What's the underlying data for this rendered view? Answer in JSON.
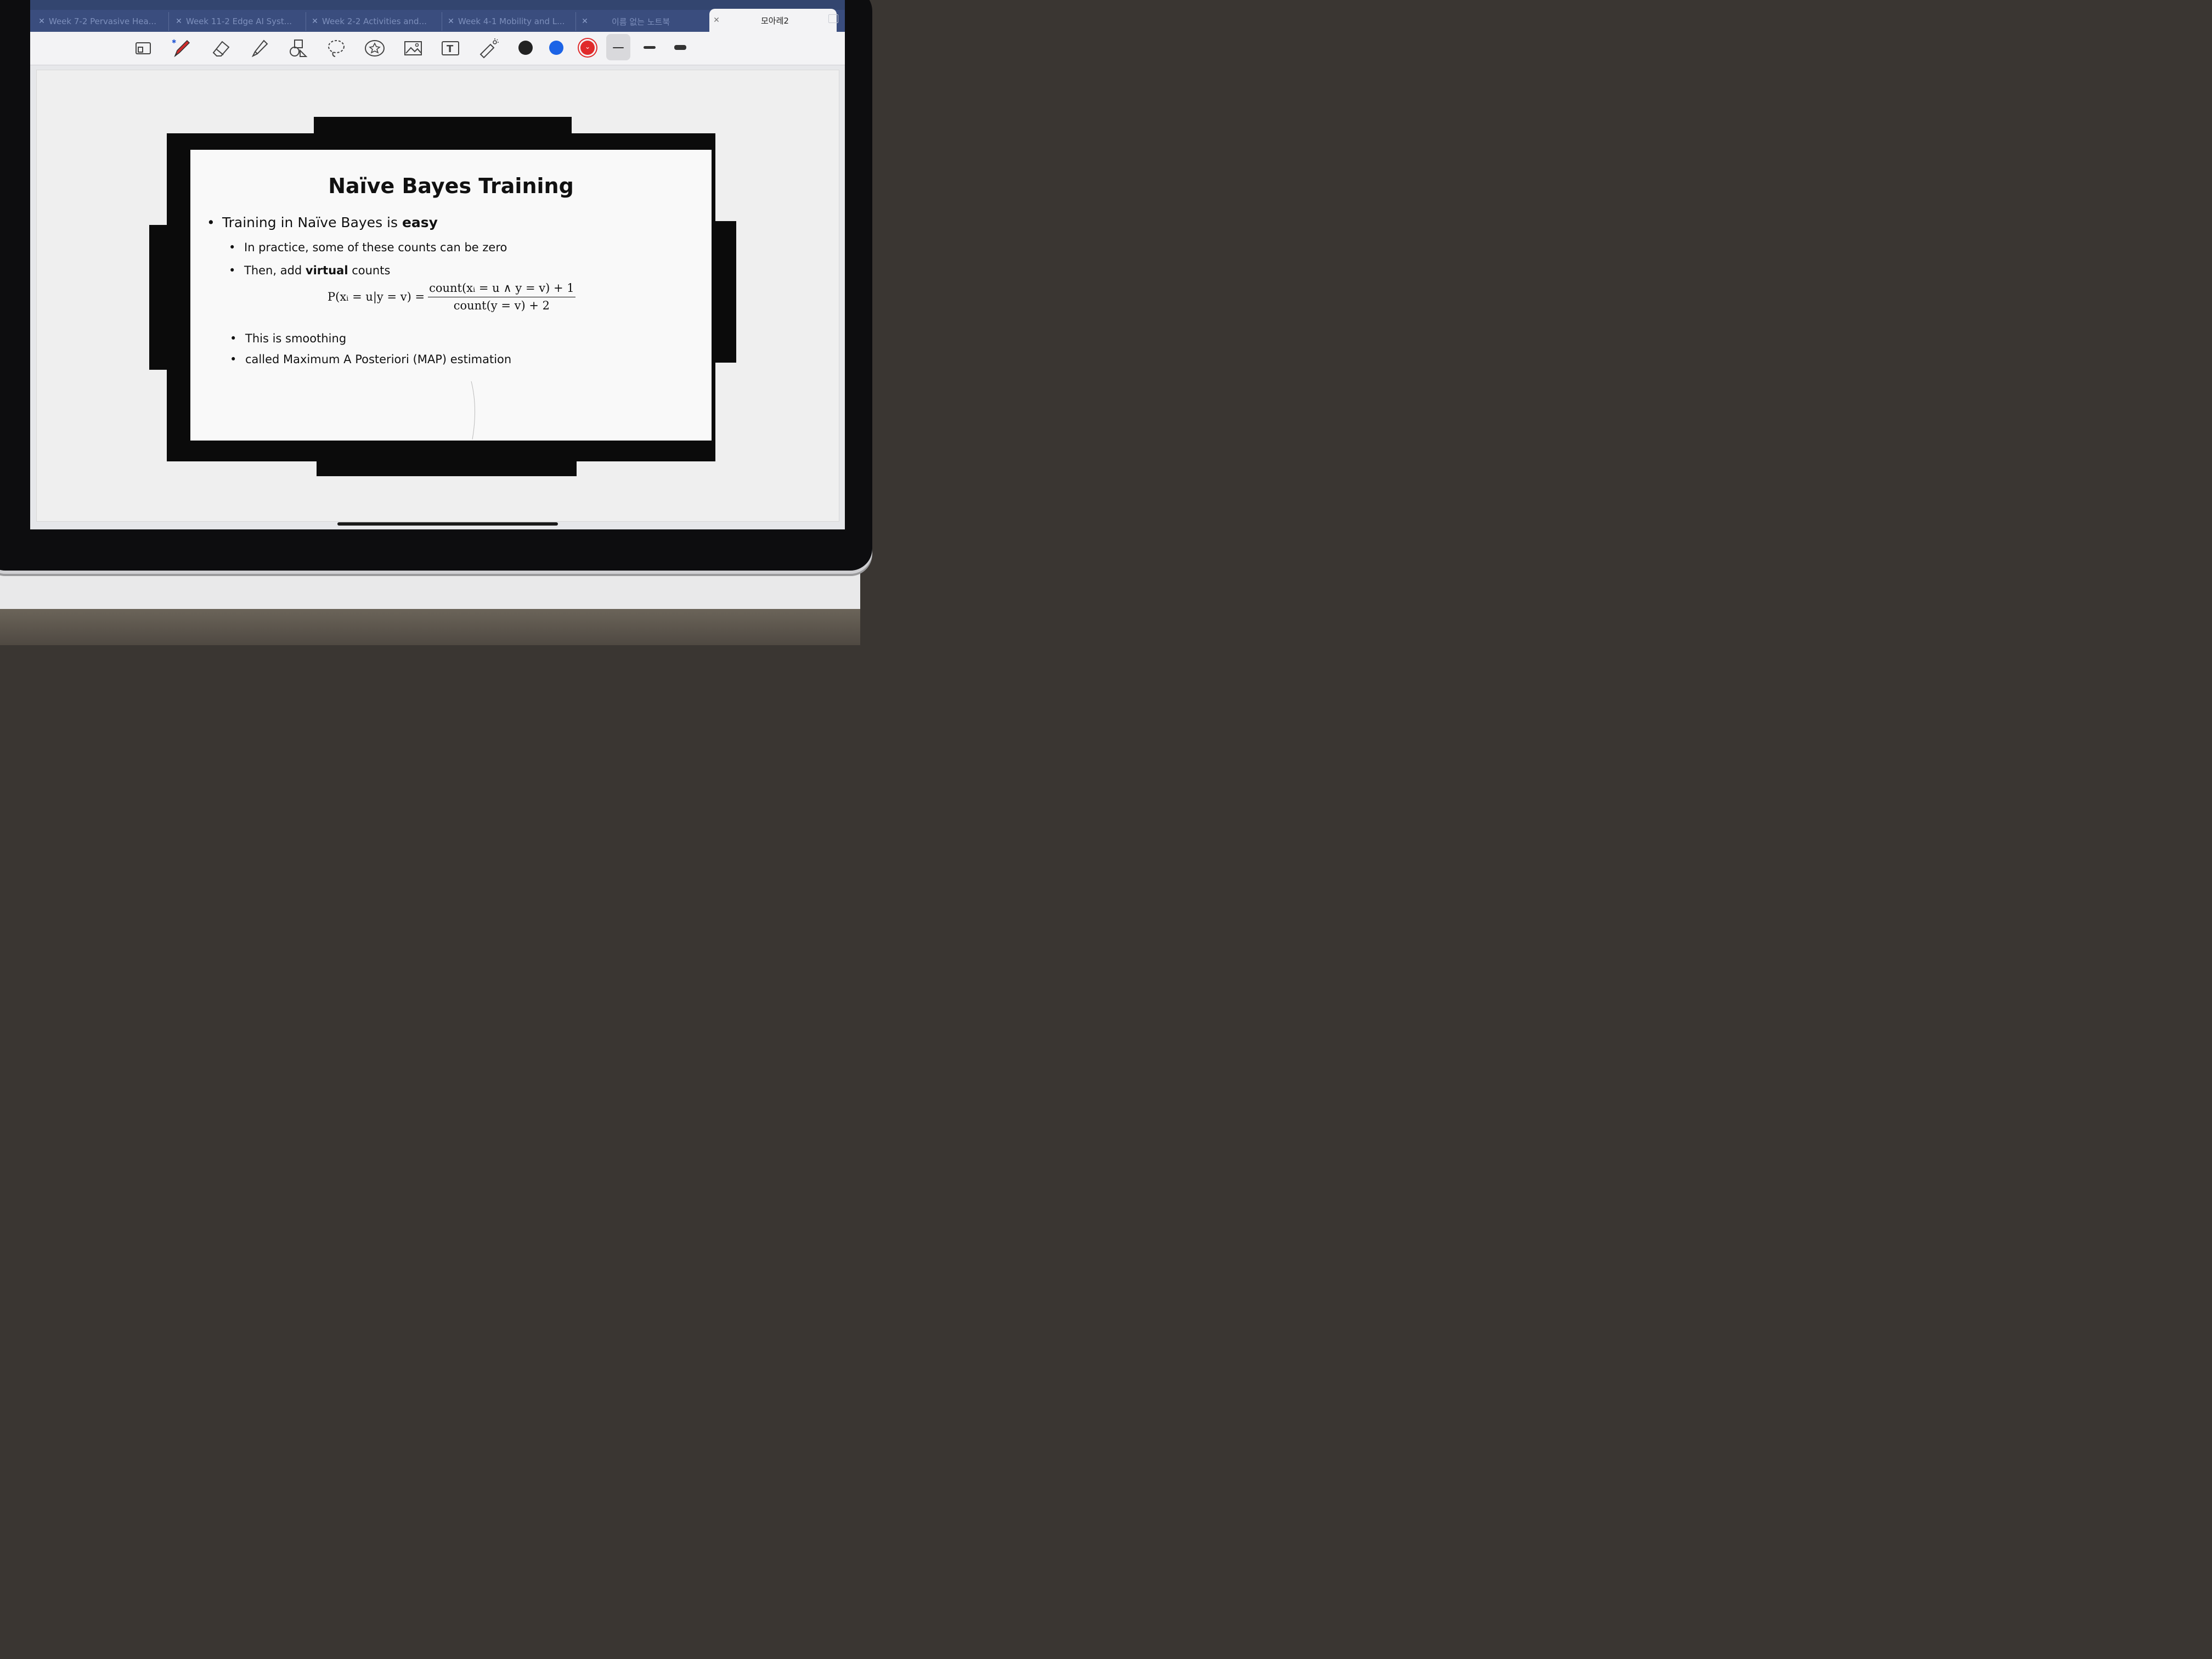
{
  "tabs": [
    {
      "label": "Week 7-2 Pervasive Hea...",
      "active": false
    },
    {
      "label": "Week 11-2 Edge AI Syst...",
      "active": false
    },
    {
      "label": "Week 2-2 Activities and...",
      "active": false
    },
    {
      "label": "Week 4-1 Mobility and L...",
      "active": false
    },
    {
      "label": "이름 없는 노트북",
      "active": false
    },
    {
      "label": "모아레2",
      "active": true
    }
  ],
  "toolbar": {
    "tools": [
      "page-layout-icon",
      "pen-icon",
      "eraser-icon",
      "highlighter-icon",
      "shapes-icon",
      "lasso-icon",
      "sticker-icon",
      "image-icon",
      "text-box-icon",
      "laser-pointer-icon"
    ],
    "colors": [
      "#222222",
      "#1c63e6",
      "#e02b2b"
    ],
    "selected_color": "#e02b2b",
    "stroke_widths": [
      "thin",
      "medium",
      "thick"
    ]
  },
  "slide": {
    "title": "Naïve Bayes Training",
    "bullet1_prefix": "Training in Naïve Bayes is ",
    "bullet1_bold": "easy",
    "sub1": "In practice, some of these counts can be zero",
    "sub2_prefix": "Then, add ",
    "sub2_bold": "virtual",
    "sub2_suffix": " counts",
    "equation_lhs": "P(xᵢ = u|y = v) =",
    "equation_num": "count(xᵢ = u ∧ y = v) + 1",
    "equation_den": "count(y = v) + 2",
    "sub3": "This is smoothing",
    "sub4": "called Maximum A Posteriori (MAP) estimation"
  }
}
